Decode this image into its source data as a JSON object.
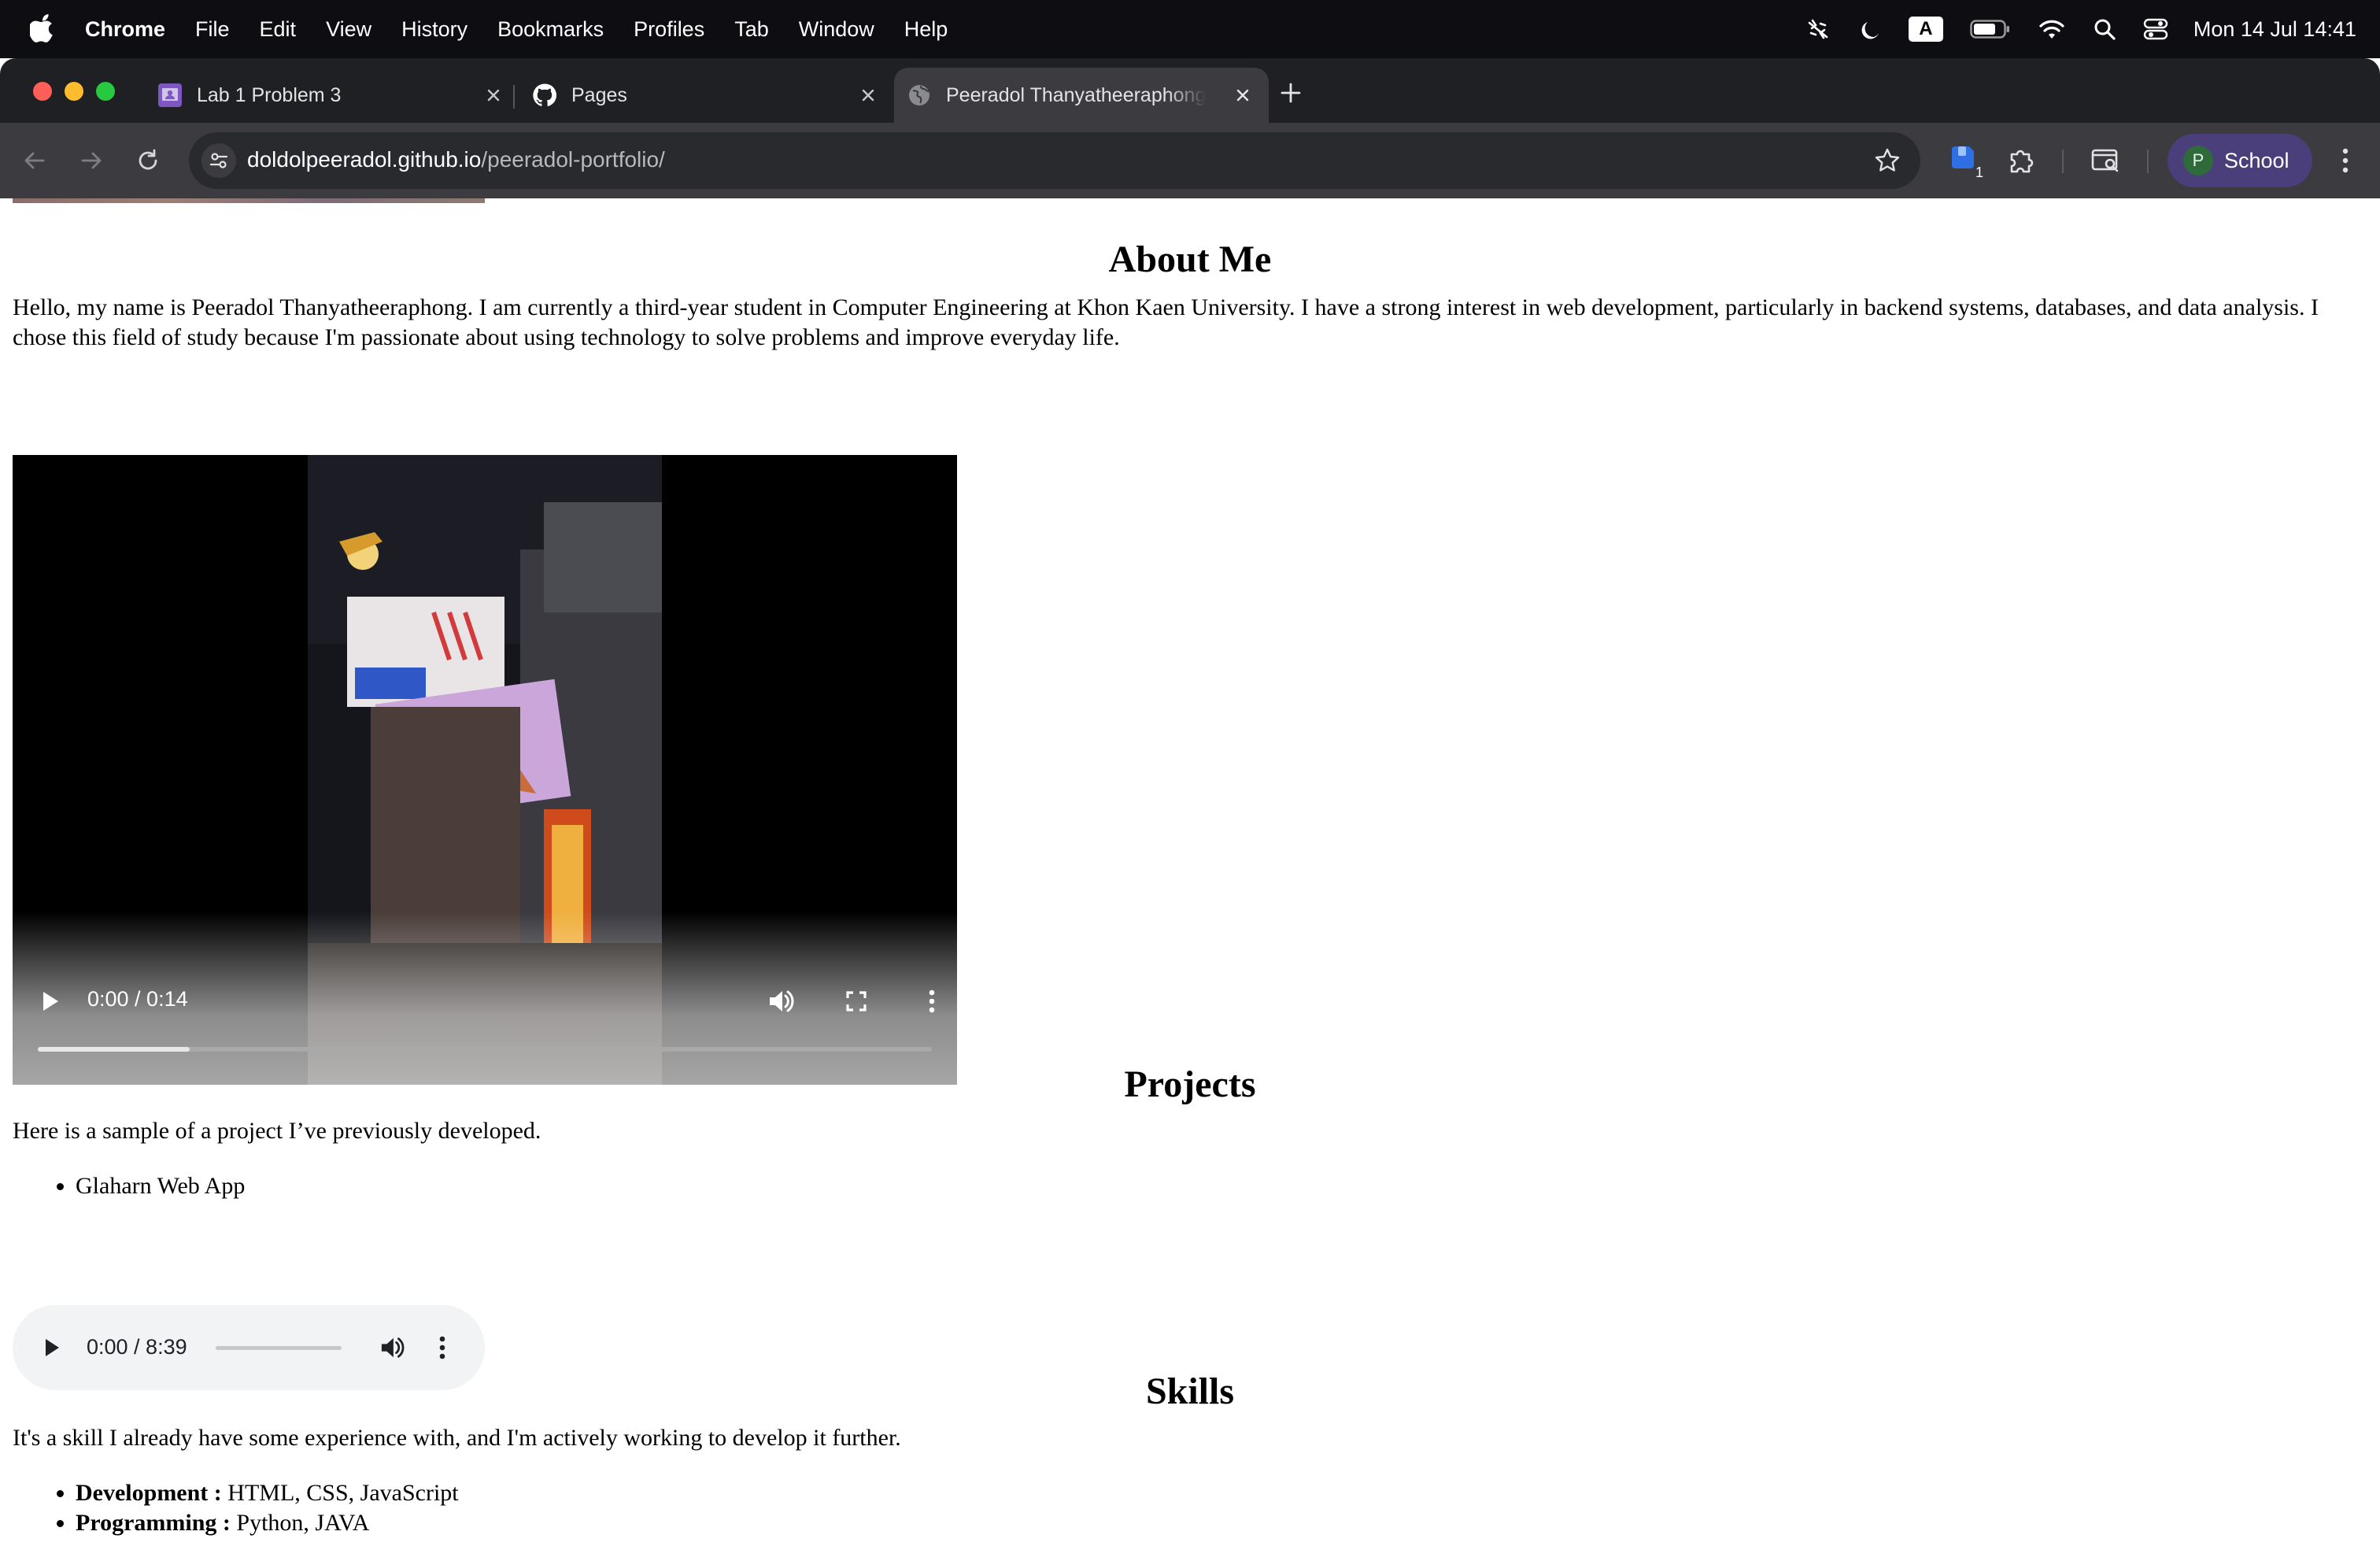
{
  "menubar": {
    "app_name": "Chrome",
    "menus": [
      "File",
      "Edit",
      "View",
      "History",
      "Bookmarks",
      "Profiles",
      "Tab",
      "Window",
      "Help"
    ],
    "input_source": "A",
    "clock": "Mon 14 Jul  14:41"
  },
  "tabs": [
    {
      "title": "Lab 1 Problem 3",
      "icon": "classroom-icon",
      "active": false
    },
    {
      "title": "Pages",
      "icon": "github-icon",
      "active": false
    },
    {
      "title": "Peeradol Thanyatheeraphong",
      "icon": "globe-icon",
      "active": true
    }
  ],
  "toolbar": {
    "url_host": "doldolpeeradol.github.io",
    "url_path": "/peeradol-portfolio/",
    "profile_initial": "P",
    "profile_name": "School",
    "extension_badge": "1"
  },
  "page": {
    "about": {
      "heading": "About Me",
      "text": "Hello, my name is Peeradol Thanyatheeraphong. I am currently a third-year student in Computer Engineering at Khon Kaen University. I have a strong interest in web development, particularly in backend systems, databases, and data analysis. I chose this field of study because I'm passionate about using technology to solve problems and improve everyday life."
    },
    "video": {
      "time": "0:00 / 0:14",
      "buffered_fraction": 0.17
    },
    "projects": {
      "heading": "Projects",
      "text": "Here is a sample of a project I’ve previously developed.",
      "items": [
        "Glaharn Web App"
      ]
    },
    "audio": {
      "time": "0:00 / 8:39"
    },
    "skills": {
      "heading": "Skills",
      "text": "It's a skill I already have some experience with, and I'm actively working to develop it further.",
      "items": [
        {
          "label": "Development :",
          "value": " HTML, CSS, JavaScript"
        },
        {
          "label": "Programming :",
          "value": " Python, JAVA"
        }
      ]
    }
  },
  "colors": {
    "menubar_bg": "#0d0d12",
    "tabstrip_bg": "#1f2023",
    "toolbar_bg": "#3c3c40",
    "omnibox_bg": "#282a2d",
    "profile_chip": "#4a3f7a"
  }
}
